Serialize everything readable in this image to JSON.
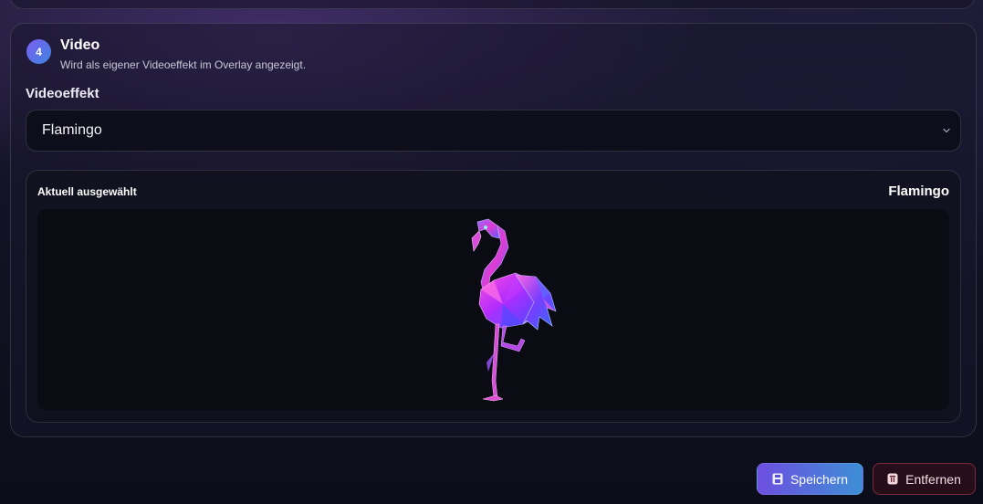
{
  "section": {
    "step_number": "4",
    "title": "Video",
    "subtitle": "Wird als eigener Videoeffekt im Overlay angezeigt."
  },
  "video_effect": {
    "label": "Videoeffekt",
    "selected": "Flamingo",
    "icon": "chevron-down-icon"
  },
  "preview": {
    "label": "Aktuell ausgewählt",
    "value": "Flamingo",
    "image": "flamingo-illustration"
  },
  "actions": {
    "save_label": "Speichern",
    "save_icon": "save-icon",
    "remove_label": "Entfernen",
    "remove_icon": "trash-icon"
  },
  "colors": {
    "accent_start": "#6d4fe0",
    "accent_end": "#3d8fd6",
    "danger_border": "#c83c5a",
    "flamingo_pink": "#e23bd0",
    "flamingo_blue": "#4a5cff"
  }
}
